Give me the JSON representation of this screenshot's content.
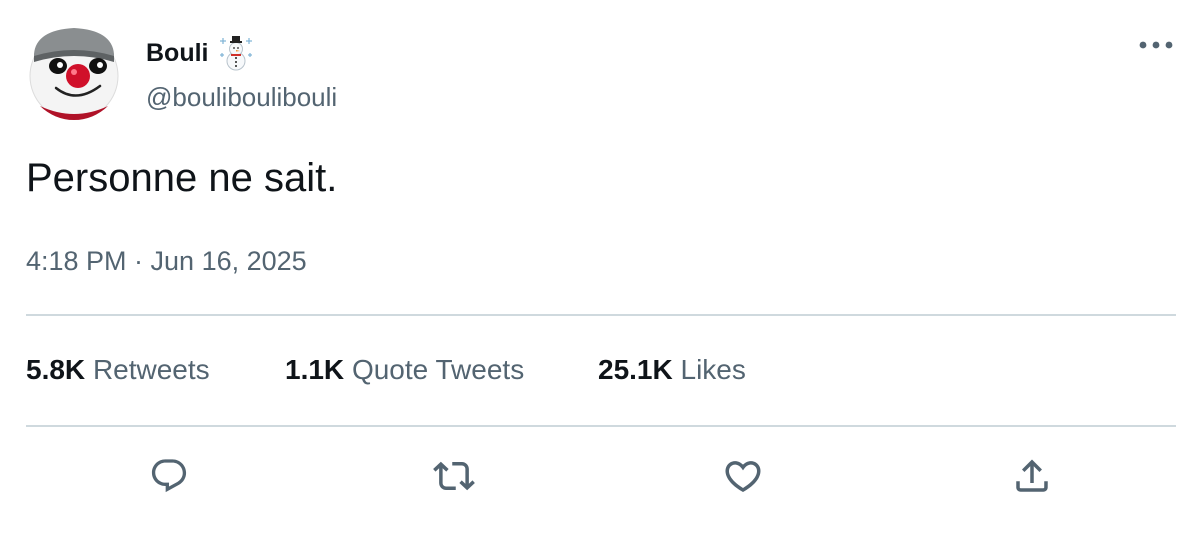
{
  "author": {
    "display_name": "Bouli",
    "handle": "@bouliboulibouli",
    "name_emoji": "snowman-emoji"
  },
  "tweet": {
    "text": "Personne ne sait.",
    "timestamp": "4:18 PM · Jun 16, 2025"
  },
  "stats": [
    {
      "count": "5.8K",
      "label": "Retweets"
    },
    {
      "count": "1.1K",
      "label": "Quote Tweets"
    },
    {
      "count": "25.1K",
      "label": "Likes"
    }
  ],
  "actions": [
    {
      "name": "reply",
      "icon": "reply-icon"
    },
    {
      "name": "retweet",
      "icon": "retweet-icon"
    },
    {
      "name": "like",
      "icon": "heart-icon"
    },
    {
      "name": "share",
      "icon": "share-icon"
    }
  ],
  "colors": {
    "text_primary": "#0f1419",
    "text_secondary": "#536471",
    "divider": "#cfd9de"
  }
}
